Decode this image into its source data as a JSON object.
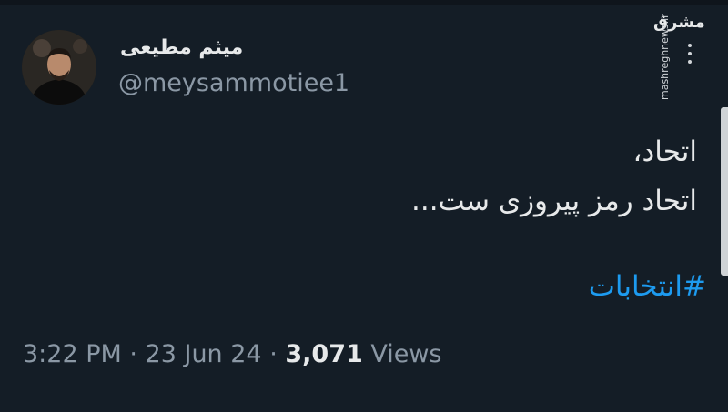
{
  "author": {
    "display_name": "میثم مطیعی",
    "handle": "@meysammotiee1"
  },
  "watermark": {
    "logo_text": "مشرق",
    "url": "mashreghnews.ir"
  },
  "tweet": {
    "lines": [
      "اتحاد،",
      "اتحاد رمز پیروزی ست..."
    ],
    "hashtag": "#انتخابات"
  },
  "meta": {
    "time": "3:22 PM",
    "sep1": " · ",
    "date": "23 Jun 24",
    "sep2": " · ",
    "views_count": "3,071",
    "views_label": " Views"
  },
  "colors": {
    "background": "#141d26",
    "primary_text": "#e7e9ea",
    "secondary_text": "#8b98a5",
    "link": "#1d9bf0"
  }
}
